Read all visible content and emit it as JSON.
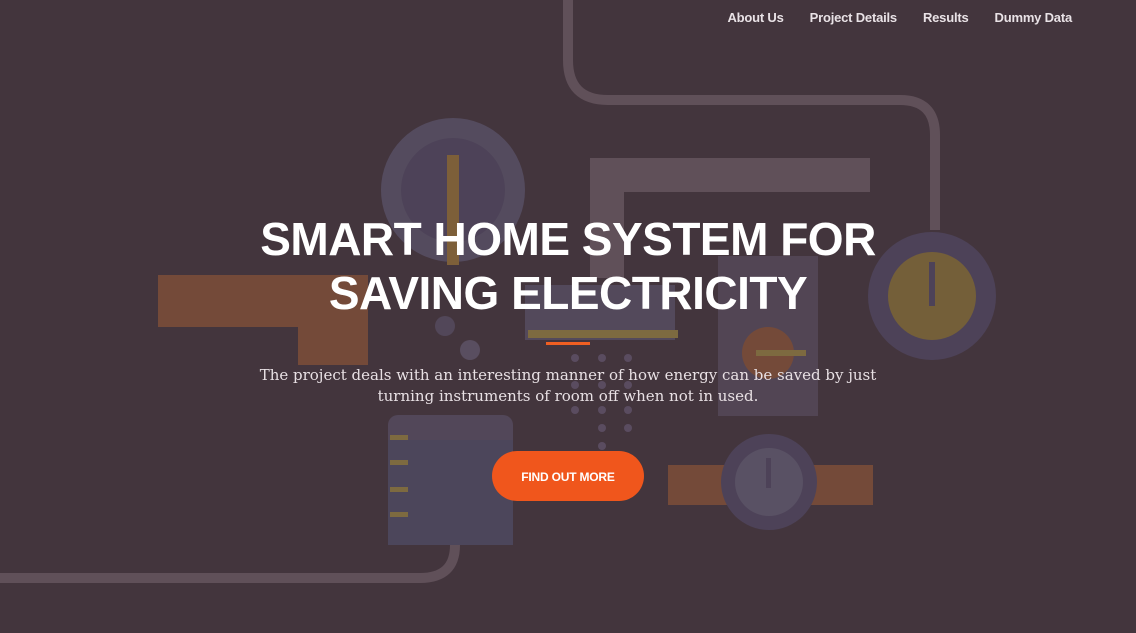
{
  "nav": {
    "items": [
      {
        "label": "About Us"
      },
      {
        "label": "Project Details"
      },
      {
        "label": "Results"
      },
      {
        "label": "Dummy Data"
      }
    ]
  },
  "hero": {
    "title_line1": "SMART HOME SYSTEM FOR",
    "title_line2": "SAVING ELECTRICITY",
    "description_line1": "The project deals with an interesting manner of how energy can be saved by just",
    "description_line2": "turning instruments of room off when not in used.",
    "cta_label": "FIND OUT MORE"
  },
  "colors": {
    "accent": "#f05f22",
    "overlay": "#4a3c44",
    "text": "#ffffff"
  }
}
